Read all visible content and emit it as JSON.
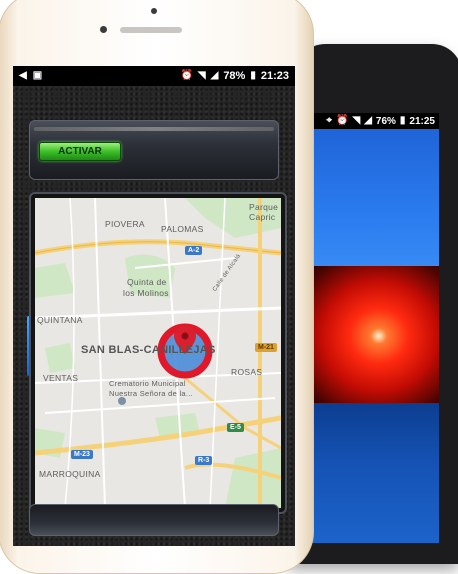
{
  "front_status": {
    "battery": "78%",
    "time": "21:23"
  },
  "back_status": {
    "battery": "76%",
    "time": "21:25"
  },
  "activate_button": {
    "label": "ACTIVAR"
  },
  "map": {
    "labels": [
      "Parque",
      "Capric",
      "PIOVERA",
      "PALOMAS",
      "Quinta de",
      "los Molinos",
      "QUINTANA",
      "SAN BLAS-CANILLEJAS",
      "ROSAS",
      "VENTAS",
      "Crematorio Municipal",
      "Nuestra Señora de la...",
      "MARROQUINA",
      "Calle de Alcalá"
    ],
    "road_badges": [
      "A-2",
      "M-21",
      "E-5",
      "M-23",
      "R-3"
    ]
  },
  "colors": {
    "activate_green": "#3cc028",
    "location_ring_red": "#e0182a",
    "alarm_red": "#ff2a10",
    "screen_blue": "#1f64d8"
  },
  "icons": [
    "notification-icon",
    "image-icon",
    "alarm-clock-icon",
    "wifi-icon",
    "signal-icon",
    "battery-icon",
    "location-pin-icon"
  ]
}
